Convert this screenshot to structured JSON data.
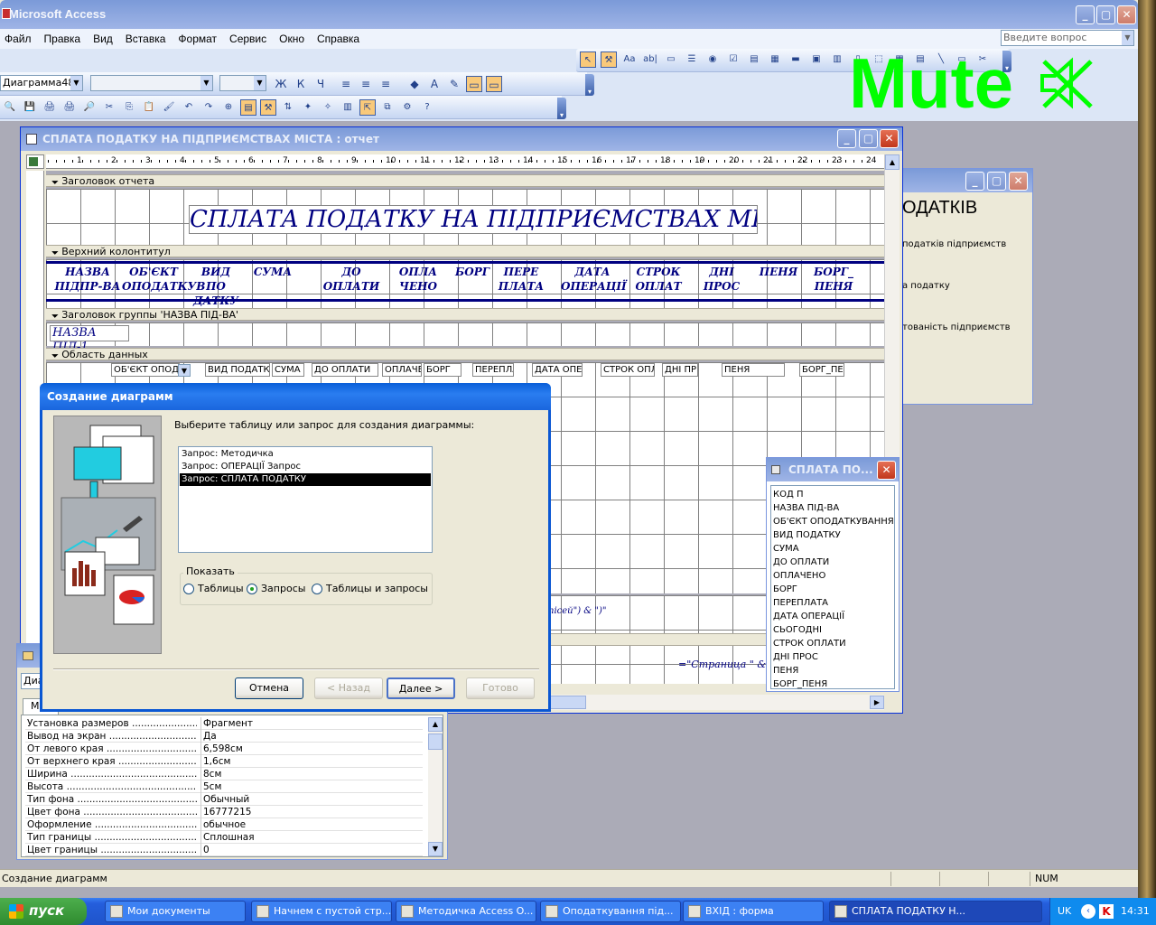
{
  "app": {
    "title": "Microsoft Access",
    "menu": [
      "Файл",
      "Правка",
      "Вид",
      "Вставка",
      "Формат",
      "Сервис",
      "Окно",
      "Справка"
    ],
    "ask_placeholder": "Введите вопрос",
    "control_combo": "Диаграмма48",
    "mute_label": "Mute"
  },
  "report": {
    "title": "СПЛАТА ПОДАТКУ НА ПІДПРИЄМСТВАХ МІСТА : отчет",
    "ruler": [
      "1",
      "2",
      "3",
      "4",
      "5",
      "6",
      "7",
      "8",
      "9",
      "10",
      "11",
      "12",
      "13",
      "14",
      "15",
      "16",
      "17",
      "18",
      "19",
      "20",
      "21",
      "22",
      "23",
      "24"
    ],
    "bands": {
      "report_header": "Заголовок отчета",
      "page_header": "Верхний колонтитул",
      "group_header": "Заголовок группы 'НАЗВА ПІД-ВА'",
      "detail": "Область данных"
    },
    "heading": "СПЛАТА ПОДАТКУ НА ПІДПРИЄМСТВАХ МІСТА",
    "columns": [
      {
        "l1": "НАЗВА",
        "l2": "ПІДПР-ВА"
      },
      {
        "l1": "ОБ'ЄКТ",
        "l2": "ОПОДАТКУВ"
      },
      {
        "l1": "ВИД ПО",
        "l2": "ДАТКУ"
      },
      {
        "l1": "СУМА",
        "l2": ""
      },
      {
        "l1": "ДО",
        "l2": "ОПЛАТИ"
      },
      {
        "l1": "ОПЛА",
        "l2": "ЧЕНО"
      },
      {
        "l1": "БОРГ",
        "l2": ""
      },
      {
        "l1": "ПЕРЕ",
        "l2": "ПЛАТА"
      },
      {
        "l1": "ДАТА",
        "l2": "ОПЕРАЦІЇ"
      },
      {
        "l1": "СТРОК",
        "l2": "ОПЛАТ"
      },
      {
        "l1": "ДНІ",
        "l2": "ПРОС"
      },
      {
        "l1": "ПЕНЯ",
        "l2": ""
      },
      {
        "l1": "БОРГ_",
        "l2": "ПЕНЯ"
      }
    ],
    "group_field": "НАЗВА ПІД-1",
    "detail_fields": [
      "ОБ'ЄКТ ОПОД",
      "ВИД ПОДАТК",
      "СУМА",
      "ДО ОПЛАТИ",
      "ОПЛАЧЕ",
      "БОРГ",
      "ПЕРЕПЛА",
      "ДАТА ОПЕ",
      "СТРОК ОПЛ",
      "ДНІ ПР",
      "ПЕНЯ",
      "БОРГ_ПЕ"
    ],
    "footer_text1": "пісей\") & \")\"",
    "footer_text2": "=\"Страница \" &["
  },
  "back_window": {
    "heading": "ОДАТКІВ",
    "lines": [
      "податків підприємств",
      "а податку",
      "тованість підприємств"
    ]
  },
  "field_list": {
    "title": "СПЛАТА ПО...",
    "fields": [
      "КОД П",
      "НАЗВА ПІД-ВА",
      "ОБ'ЄКТ ОПОДАТКУВАННЯ",
      "ВИД ПОДАТКУ",
      "СУМА",
      "ДО ОПЛАТИ",
      "ОПЛАЧЕНО",
      "БОРГ",
      "ПЕРЕПЛАТА",
      "ДАТА ОПЕРАЦІЇ",
      "СЬОГОДНІ",
      "СТРОК ОПЛАТИ",
      "ДНІ ПРОС",
      "ПЕНЯ",
      "БОРГ_ПЕНЯ"
    ]
  },
  "dialog": {
    "title": "Создание диаграмм",
    "prompt": "Выберите таблицу или запрос для создания диаграммы:",
    "items": [
      "Запрос: Методичка",
      "Запрос: ОПЕРАЦІЇ Запрос",
      "Запрос: СПЛАТА ПОДАТКУ"
    ],
    "selected_index": 2,
    "show_label": "Показать",
    "options": [
      "Таблицы",
      "Запросы",
      "Таблицы и запросы"
    ],
    "selected_option": 1,
    "buttons": {
      "cancel": "Отмена",
      "back": "< Назад",
      "next": "Далее >",
      "finish": "Готово"
    }
  },
  "properties": {
    "combo": "Диа",
    "tab": "Ма",
    "rows": [
      {
        "name": "Установка размеров",
        "value": "Фрагмент"
      },
      {
        "name": "Вывод на экран",
        "value": "Да"
      },
      {
        "name": "От левого края",
        "value": "6,598см"
      },
      {
        "name": "От верхнего края",
        "value": "1,6см"
      },
      {
        "name": "Ширина",
        "value": "8см"
      },
      {
        "name": "Высота",
        "value": "5см"
      },
      {
        "name": "Тип фона",
        "value": "Обычный"
      },
      {
        "name": "Цвет фона",
        "value": "16777215"
      },
      {
        "name": "Оформление",
        "value": "обычное"
      },
      {
        "name": "Тип границы",
        "value": "Сплошная"
      },
      {
        "name": "Цвет границы",
        "value": "0"
      }
    ]
  },
  "status": {
    "text": "Создание диаграмм",
    "num": "NUM"
  },
  "taskbar": {
    "start": "пуск",
    "items": [
      "Мои документы",
      "Начнем с пустой стр...",
      "Методичка Access O...",
      "Оподаткування під...",
      "ВХІД : форма",
      "СПЛАТА ПОДАТКУ Н..."
    ],
    "lang": "UK",
    "clock": "14:31"
  },
  "colors": {
    "xp_blue": "#245EDC",
    "mute_green": "#00FF00",
    "report_text": "#000080",
    "desktop": "#ABABB7"
  }
}
